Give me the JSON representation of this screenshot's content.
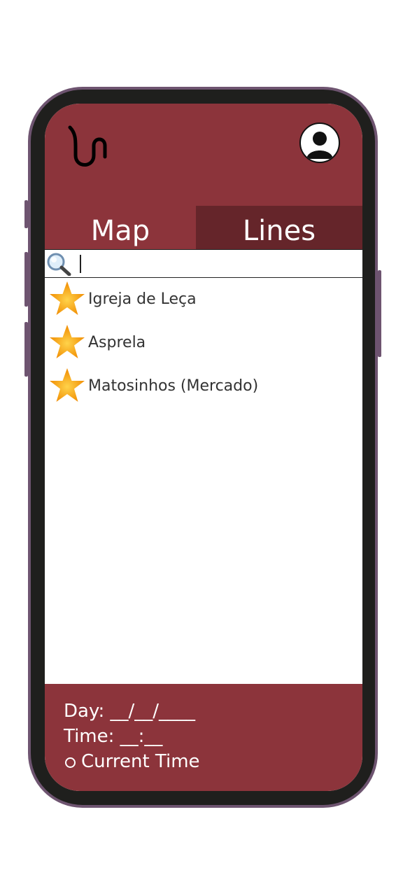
{
  "tabs": {
    "map": "Map",
    "lines": "Lines"
  },
  "search": {
    "value": "",
    "icon": "search-icon"
  },
  "favorites": [
    {
      "label": "Igreja de Leça",
      "icon": "star-icon"
    },
    {
      "label": "Asprela",
      "icon": "star-icon"
    },
    {
      "label": "Matosinhos (Mercado)",
      "icon": "star-icon"
    }
  ],
  "footer": {
    "day_label": "Day: __/__/____",
    "time_label": "Time: __:__",
    "current_time_label": "Current Time"
  },
  "colors": {
    "brand": "#8c343b",
    "tab_active": "#65252a",
    "frame": "#1f1f1d",
    "frame_border": "#6e5470",
    "star": "#f59a0a"
  }
}
